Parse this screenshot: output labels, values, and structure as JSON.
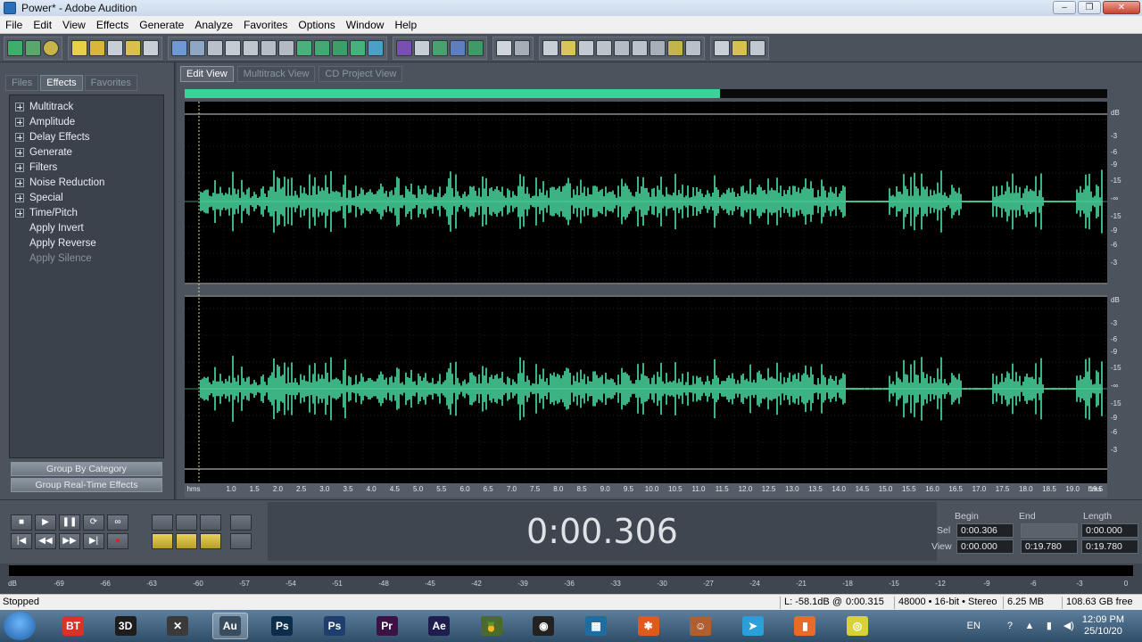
{
  "window": {
    "title": "Power* - Adobe Audition",
    "minimize": "–",
    "maximize": "❐",
    "close": "✕"
  },
  "menu": [
    "File",
    "Edit",
    "View",
    "Effects",
    "Generate",
    "Analyze",
    "Favorites",
    "Options",
    "Window",
    "Help"
  ],
  "left_panel": {
    "tabs": [
      "Files",
      "Effects",
      "Favorites"
    ],
    "active_tab": "Effects",
    "tree": [
      {
        "label": "Multitrack",
        "expandable": true
      },
      {
        "label": "Amplitude",
        "expandable": true
      },
      {
        "label": "Delay Effects",
        "expandable": true
      },
      {
        "label": "Generate",
        "expandable": true
      },
      {
        "label": "Filters",
        "expandable": true
      },
      {
        "label": "Noise Reduction",
        "expandable": true
      },
      {
        "label": "Special",
        "expandable": true
      },
      {
        "label": "Time/Pitch",
        "expandable": true
      },
      {
        "label": "Apply Invert",
        "expandable": false
      },
      {
        "label": "Apply Reverse",
        "expandable": false
      },
      {
        "label": "Apply Silence",
        "expandable": false,
        "disabled": true
      }
    ],
    "group_by_category": "Group By Category",
    "group_realtime": "Group Real-Time Effects"
  },
  "main": {
    "view_tabs": [
      "Edit View",
      "Multitrack View",
      "CD Project View"
    ],
    "active_view": "Edit View",
    "overview_fraction": 0.58,
    "waveform_color": "#4ce0a4",
    "db_labels": [
      "dB",
      "-3",
      "-6",
      "-9",
      "-15",
      "-∞",
      "-15",
      "-9",
      "-6",
      "-3"
    ],
    "time_ruler": {
      "unit": "hms",
      "ticks": [
        "1.0",
        "1.5",
        "2.0",
        "2.5",
        "3.0",
        "3.5",
        "4.0",
        "4.5",
        "5.0",
        "5.5",
        "6.0",
        "6.5",
        "7.0",
        "7.5",
        "8.0",
        "8.5",
        "9.0",
        "9.5",
        "10.0",
        "10.5",
        "11.0",
        "11.5",
        "12.0",
        "12.5",
        "13.0",
        "13.5",
        "14.0",
        "14.5",
        "15.0",
        "15.5",
        "16.0",
        "16.5",
        "17.0",
        "17.5",
        "18.0",
        "18.5",
        "19.0",
        "19.5"
      ],
      "end_unit": "hms"
    }
  },
  "transport": {
    "row1": [
      "■",
      "▶",
      "❚❚",
      "⟳",
      "∞"
    ],
    "row2": [
      "|◀",
      "◀◀",
      "▶▶",
      "▶|",
      "●"
    ],
    "time_display": "0:00.306",
    "selection": {
      "headers": [
        "Begin",
        "End",
        "Length"
      ],
      "sel_label": "Sel",
      "view_label": "View",
      "sel": [
        "0:00.306",
        "",
        "0:00.000"
      ],
      "view": [
        "0:00.000",
        "0:19.780",
        "0:19.780"
      ]
    }
  },
  "level_meter": {
    "labels": [
      "dB",
      "-69",
      "-66",
      "-63",
      "-60",
      "-57",
      "-54",
      "-51",
      "-48",
      "-45",
      "-42",
      "-39",
      "-36",
      "-33",
      "-30",
      "-27",
      "-24",
      "-21",
      "-18",
      "-15",
      "-12",
      "-9",
      "-6",
      "-3",
      "0"
    ]
  },
  "status": {
    "state": "Stopped",
    "level": "L: -58.1dB @",
    "position": "0:00.315",
    "format": "48000 • 16-bit • Stereo",
    "size": "6.25 MB",
    "free": "108.63 GB free"
  },
  "taskbar": {
    "apps": [
      {
        "name": "bittorrent-icon",
        "label": "BT",
        "color": "#d8322a"
      },
      {
        "name": "3d-app-icon",
        "label": "3D",
        "color": "#1d1d1d"
      },
      {
        "name": "tools-icon",
        "label": "✕",
        "color": "#3a3a3a"
      },
      {
        "name": "audition-icon",
        "label": "Au",
        "color": "#3a4d5e",
        "active": true
      },
      {
        "name": "photoshop-icon",
        "label": "Ps",
        "color": "#0d2d4d"
      },
      {
        "name": "photoshop-alt-icon",
        "label": "Ps",
        "color": "#1e3f6e"
      },
      {
        "name": "premiere-icon",
        "label": "Pr",
        "color": "#3a1245"
      },
      {
        "name": "after-effects-icon",
        "label": "Ae",
        "color": "#1d1e4d"
      },
      {
        "name": "fruity-icon",
        "label": "🍍",
        "color": "#4d6a2d"
      },
      {
        "name": "camera-icon",
        "label": "◉",
        "color": "#222"
      },
      {
        "name": "windows-grid-icon",
        "label": "▦",
        "color": "#1f6d9e"
      },
      {
        "name": "puzzle-icon",
        "label": "✱",
        "color": "#e05a1e"
      },
      {
        "name": "avatar-icon",
        "label": "☺",
        "color": "#b06030"
      },
      {
        "name": "telegram-icon",
        "label": "➤",
        "color": "#2b9fd9"
      },
      {
        "name": "office-icon",
        "label": "▮",
        "color": "#e96b2a"
      },
      {
        "name": "chrome-icon",
        "label": "◎",
        "color": "#d8d23a"
      }
    ],
    "lang": "EN",
    "time": "12:09 PM",
    "date": "25/10/20"
  }
}
